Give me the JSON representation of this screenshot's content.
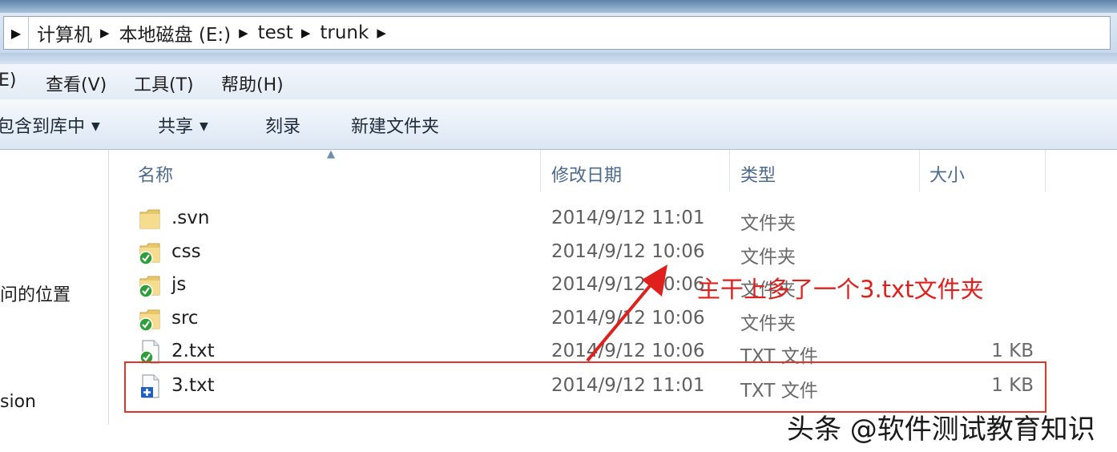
{
  "address_bar": {
    "crumbs": [
      "计算机",
      "本地磁盘 (E:)",
      "test",
      "trunk"
    ]
  },
  "menu_bar": {
    "edit": "E)",
    "view": "查看(V)",
    "tools": "工具(T)",
    "help": "帮助(H)"
  },
  "toolbar": {
    "include_in_library": "包含到库中",
    "share": "共享",
    "burn": "刻录",
    "new_folder": "新建文件夹"
  },
  "nav_pane": {
    "recent_places": "问的位置",
    "version": "sion"
  },
  "columns": {
    "name": "名称",
    "modified": "修改日期",
    "type": "类型",
    "size": "大小"
  },
  "files": [
    {
      "name": ".svn",
      "modified": "2014/9/12 11:01",
      "type": "文件夹",
      "size": "",
      "icon": "folder-icon"
    },
    {
      "name": "css",
      "modified": "2014/9/12 10:06",
      "type": "文件夹",
      "size": "",
      "icon": "svn-folder-icon"
    },
    {
      "name": "js",
      "modified": "2014/9/12 10:06",
      "type": "文件夹",
      "size": "",
      "icon": "svn-folder-icon"
    },
    {
      "name": "src",
      "modified": "2014/9/12 10:06",
      "type": "文件夹",
      "size": "",
      "icon": "svn-folder-icon"
    },
    {
      "name": "2.txt",
      "modified": "2014/9/12 10:06",
      "type": "TXT 文件",
      "size": "1 KB",
      "icon": "svn-file-icon"
    },
    {
      "name": "3.txt",
      "modified": "2014/9/12 11:01",
      "type": "TXT 文件",
      "size": "1 KB",
      "icon": "svn-added-file-icon"
    }
  ],
  "annotation": {
    "text": "主干上多了一个3.txt文件夹",
    "color": "#e0201c"
  },
  "watermark": "头条 @软件测试教育知识"
}
